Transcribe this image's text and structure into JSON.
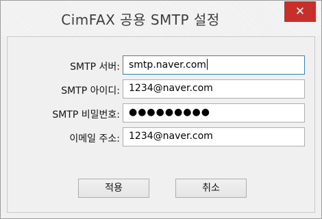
{
  "window": {
    "title": "CimFAX 공용 SMTP 설정",
    "close_glyph": "✕"
  },
  "form": {
    "server_label": "SMTP 서버:",
    "server_value": "smtp.naver.com",
    "id_label": "SMTP 아이디:",
    "id_value": "1234@naver.com",
    "password_label": "SMTP 비밀번호:",
    "password_mask": "●●●●●●●●●",
    "email_label": "이메일 주소:",
    "email_value": "1234@naver.com"
  },
  "buttons": {
    "apply_label": "적용",
    "cancel_label": "취소"
  },
  "colors": {
    "close_button": "#c7302a",
    "dialog_bg": "#f0f0f0",
    "focus_border": "#3c7fb1"
  }
}
